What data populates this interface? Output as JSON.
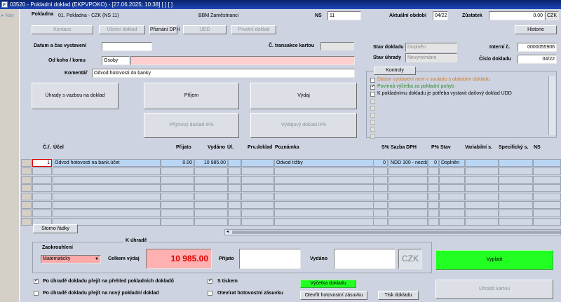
{
  "window": {
    "title": "03520 - Pokladní doklad (EKPVPOKO) - [27.06.2025; 10:38]  [ ]  [ ]"
  },
  "nav": {
    "label": "Nav"
  },
  "header": {
    "pokladna_label": "Pokladna",
    "pokladna_value": "01. Pokladna - CZK (NS 11)",
    "company": "BBM Zaměstnanci",
    "ns_label": "NS",
    "ns_value": "11",
    "obdobi_label": "Aktuální období",
    "obdobi_value": "04/22",
    "zustatek_label": "Zůstatek",
    "zustatek_value": "0.00",
    "zustatek_currency": "CZK"
  },
  "toolbar": {
    "kontace": "Kontace",
    "ucetni_doklad": "Účetní doklad",
    "priznani_dph": "Přiznání DPH",
    "udd": "UDD",
    "prvotni_doklad": "Prvotní doklad",
    "historie": "Historie"
  },
  "form": {
    "datum_label": "Datum a čas vystavení",
    "datum_value": "",
    "transakce_label": "Č. transakce kartou",
    "transakce_value": "",
    "odkoho_label": "Od koho / komu",
    "odkoho_value": "Osoby",
    "odkoho_name": "",
    "komentar_label": "Komentář",
    "komentar_value": "Odvod hotovosti do banky",
    "stav_dokladu_label": "Stav dokladu",
    "stav_dokladu_value": "Doplněn",
    "stav_uhrady_label": "Stav úhrady",
    "stav_uhrady_value": "Nevyrovnáno",
    "interni_label": "Interní č.",
    "interni_value": "0000055906",
    "cislo_label": "Číslo dokladu",
    "cislo_value": "04/22"
  },
  "actions": {
    "uhrady": "Úhrady s vazbou na doklad",
    "prijem": "Příjem",
    "vydaj": "Výdaj",
    "prijmovy_ips": "Příjmový doklad IPS",
    "vydajovy_ips": "Výdajový doklad IPS"
  },
  "kontroly": {
    "title": "Kontroly",
    "items": [
      {
        "text": "Datum vystavení není v souladu s obdobím dokladu",
        "checked": false,
        "color": "#d07a2a"
      },
      {
        "text": "Povinná výčetka za pokladní pohyb",
        "checked": true,
        "color": "#2a8a2a"
      },
      {
        "text": "K pokladnímu dokladu je potřeba vystavit daňový doklad UDD",
        "checked": false,
        "color": "#000000"
      }
    ]
  },
  "grid": {
    "headers": {
      "cr": "Č.ř.",
      "ucel": "Účel",
      "prijato": "Přijato",
      "vydano": "Vydáno",
      "ul": "Úl.",
      "prv": "Prv.doklad",
      "poznamka": "Poznámka",
      "s": "S%",
      "sazba": "Sazba DPH",
      "p": "P%",
      "stav": "Stav",
      "variabilni": "Variabilní s.",
      "specificky": "Specifický s.",
      "ns": "NS"
    },
    "rows": [
      {
        "cr": "1",
        "ucel": "Odvod hotovosti na bank.účet",
        "prijato": "0.00",
        "vydano": "10 985.00",
        "ul": "",
        "prv": "",
        "poznamka": "Odvod tržby",
        "s": "0",
        "sazba": "NDD 100 - nezda",
        "p": "0",
        "stav": "Doplněn",
        "variabilni": "",
        "specificky": "",
        "ns": ""
      }
    ],
    "storno": "Storno řádky"
  },
  "uhrada": {
    "title": "K úhradě",
    "zaokrouhleni_label": "Zaokrouhlení",
    "zaokrouhleni_value": "Matematicky",
    "celkem_label": "Celkem výdaj",
    "celkem_value": "10 985.00",
    "prijato_label": "Přijato",
    "prijato_value": "",
    "vydano_label": "Vydáno",
    "vydano_value": "",
    "currency": "CZK",
    "vyplatit": "Vyplatit",
    "uhradit_kartou": "Uhradit kartou"
  },
  "footer": {
    "opt1": "Po úhradě dokladu přejít na přehled pokladních dokladů",
    "opt1_checked": true,
    "opt2": "Po úhradě dokladu přejít na nový pokladní doklad",
    "opt2_checked": false,
    "tiskem": "S tiskem",
    "tiskem_checked": true,
    "zasuvka": "Otevírat hotovostní zásuvku",
    "zasuvka_checked": false,
    "vycetka": "Výčetka dokladu",
    "otevrit": "Otevřít hotovostní zásuvku",
    "tisk": "Tisk dokladu"
  },
  "colors": {
    "green": "#22ff22",
    "pink": "#ffa8a8",
    "red": "#e00000"
  }
}
